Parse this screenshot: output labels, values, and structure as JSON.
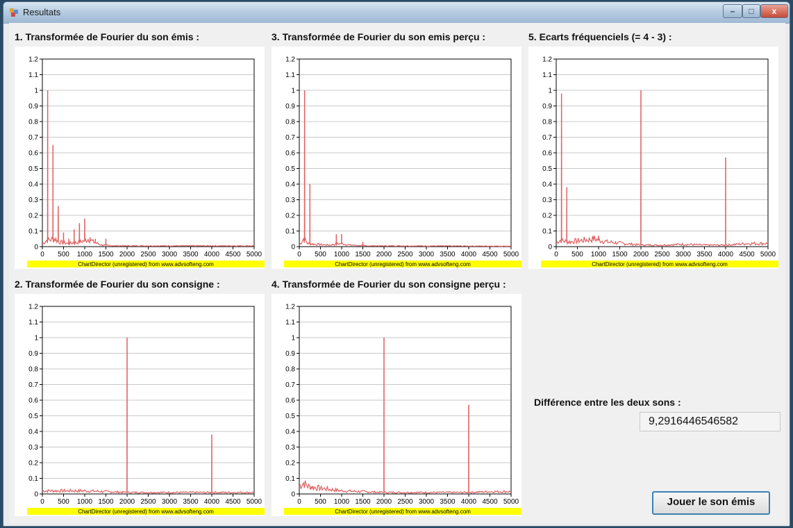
{
  "window": {
    "title": "Resultats",
    "controls": {
      "minimize": "–",
      "maximize": "□",
      "close": "x"
    }
  },
  "charts_watermark": "ChartDirector (unregistered) from www.advsofteng.com",
  "colors": {
    "line": "#e06060",
    "grid": "#c8c8c8",
    "watermark_bg": "#ffff00"
  },
  "panel_titles": [
    "1. Transformée de Fourier du son émis :",
    "3. Transformée de Fourier du son emis perçu :",
    "5. Ecarts fréquenciels (= 4 - 3) :",
    "2. Transformée de Fourier du son consigne :",
    "4. Transformée de Fourier du son consigne perçu :"
  ],
  "difference": {
    "label": "Différence entre les deux sons :",
    "value": "9,2916446546582"
  },
  "play_button": "Jouer le son émis",
  "chart_data": [
    {
      "type": "line",
      "xlim": [
        0,
        5000
      ],
      "ylim": [
        0,
        1.2
      ],
      "xticks": [
        0,
        500,
        1000,
        1500,
        2000,
        2500,
        3000,
        3500,
        4000,
        4500,
        5000
      ],
      "yticks": [
        "0",
        "0.1",
        "0.2",
        "0.3",
        "0.4",
        "0.5",
        "0.6",
        "0.7",
        "0.8",
        "0.9",
        "1",
        "1.1",
        "1.2"
      ],
      "grid": true,
      "baseline": [
        [
          0,
          0.02
        ],
        [
          100,
          0.04
        ],
        [
          300,
          0.05
        ],
        [
          400,
          0.03
        ],
        [
          600,
          0.02
        ],
        [
          900,
          0.03
        ],
        [
          1100,
          0.05
        ],
        [
          1200,
          0.03
        ],
        [
          1400,
          0.01
        ],
        [
          1700,
          0.005
        ],
        [
          5000,
          0.005
        ]
      ],
      "peaks": [
        [
          125,
          1.0
        ],
        [
          250,
          0.65
        ],
        [
          375,
          0.26
        ],
        [
          500,
          0.09
        ],
        [
          625,
          0.05
        ],
        [
          750,
          0.11
        ],
        [
          875,
          0.15
        ],
        [
          1000,
          0.18
        ],
        [
          1125,
          0.06
        ],
        [
          1250,
          0.05
        ],
        [
          1500,
          0.05
        ]
      ]
    },
    {
      "type": "line",
      "xlim": [
        0,
        5000
      ],
      "ylim": [
        0,
        1.2
      ],
      "xticks": [
        0,
        500,
        1000,
        1500,
        2000,
        2500,
        3000,
        3500,
        4000,
        4500,
        5000
      ],
      "yticks": [
        "0",
        "0.1",
        "0.2",
        "0.3",
        "0.4",
        "0.5",
        "0.6",
        "0.7",
        "0.8",
        "0.9",
        "1",
        "1.1",
        "1.2"
      ],
      "grid": true,
      "baseline": [
        [
          0,
          0.01
        ],
        [
          100,
          0.05
        ],
        [
          200,
          0.02
        ],
        [
          400,
          0.015
        ],
        [
          700,
          0.01
        ],
        [
          1000,
          0.02
        ],
        [
          1200,
          0.01
        ],
        [
          1600,
          0.005
        ],
        [
          5000,
          0.003
        ]
      ],
      "peaks": [
        [
          125,
          1.0
        ],
        [
          250,
          0.4
        ],
        [
          875,
          0.08
        ],
        [
          1000,
          0.08
        ],
        [
          1500,
          0.03
        ]
      ]
    },
    {
      "type": "line",
      "xlim": [
        0,
        5000
      ],
      "ylim": [
        0,
        1.2
      ],
      "xticks": [
        0,
        500,
        1000,
        1500,
        2000,
        2500,
        3000,
        3500,
        4000,
        4500,
        5000
      ],
      "yticks": [
        "0",
        "0.1",
        "0.2",
        "0.3",
        "0.4",
        "0.5",
        "0.6",
        "0.7",
        "0.8",
        "0.9",
        "1",
        "1.1",
        "1.2"
      ],
      "grid": true,
      "baseline": [
        [
          0,
          0.03
        ],
        [
          100,
          0.04
        ],
        [
          300,
          0.03
        ],
        [
          600,
          0.04
        ],
        [
          900,
          0.05
        ],
        [
          1200,
          0.03
        ],
        [
          1600,
          0.02
        ],
        [
          2000,
          0.01
        ],
        [
          2500,
          0.01
        ],
        [
          3000,
          0.015
        ],
        [
          3500,
          0.01
        ],
        [
          4000,
          0.01
        ],
        [
          4500,
          0.02
        ],
        [
          5000,
          0.02
        ]
      ],
      "peaks": [
        [
          125,
          0.98
        ],
        [
          250,
          0.38
        ],
        [
          875,
          0.06
        ],
        [
          1000,
          0.07
        ],
        [
          2000,
          1.0
        ],
        [
          4000,
          0.57
        ]
      ]
    },
    {
      "type": "line",
      "xlim": [
        0,
        5000
      ],
      "ylim": [
        0,
        1.2
      ],
      "xticks": [
        0,
        500,
        1000,
        1500,
        2000,
        2500,
        3000,
        3500,
        4000,
        4500,
        5000
      ],
      "yticks": [
        "0",
        "0.1",
        "0.2",
        "0.3",
        "0.4",
        "0.5",
        "0.6",
        "0.7",
        "0.8",
        "0.9",
        "1",
        "1.1",
        "1.2"
      ],
      "grid": true,
      "baseline": [
        [
          0,
          0.02
        ],
        [
          500,
          0.02
        ],
        [
          1000,
          0.02
        ],
        [
          1500,
          0.015
        ],
        [
          2000,
          0.01
        ],
        [
          2500,
          0.01
        ],
        [
          3000,
          0.01
        ],
        [
          3500,
          0.01
        ],
        [
          4000,
          0.01
        ],
        [
          4500,
          0.01
        ],
        [
          5000,
          0.01
        ]
      ],
      "peaks": [
        [
          2000,
          1.0
        ],
        [
          4000,
          0.38
        ]
      ]
    },
    {
      "type": "line",
      "xlim": [
        0,
        5000
      ],
      "ylim": [
        0,
        1.2
      ],
      "xticks": [
        0,
        500,
        1000,
        1500,
        2000,
        2500,
        3000,
        3500,
        4000,
        4500,
        5000
      ],
      "yticks": [
        "0",
        "0.1",
        "0.2",
        "0.3",
        "0.4",
        "0.5",
        "0.6",
        "0.7",
        "0.8",
        "0.9",
        "1",
        "1.1",
        "1.2"
      ],
      "grid": true,
      "baseline": [
        [
          0,
          0.05
        ],
        [
          100,
          0.07
        ],
        [
          200,
          0.05
        ],
        [
          400,
          0.04
        ],
        [
          700,
          0.03
        ],
        [
          1000,
          0.02
        ],
        [
          1500,
          0.015
        ],
        [
          2000,
          0.01
        ],
        [
          2500,
          0.01
        ],
        [
          3000,
          0.01
        ],
        [
          3500,
          0.01
        ],
        [
          4000,
          0.01
        ],
        [
          4500,
          0.015
        ],
        [
          5000,
          0.015
        ]
      ],
      "peaks": [
        [
          2000,
          1.0
        ],
        [
          4000,
          0.57
        ]
      ]
    }
  ]
}
